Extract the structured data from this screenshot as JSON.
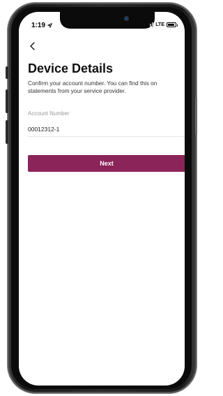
{
  "status_bar": {
    "time": "1:19",
    "network": "LTE"
  },
  "header": {
    "back_icon": "chevron-left-icon",
    "title": "Device Details",
    "subtitle": "Confirm your account number. You can find this on statements from your service provider."
  },
  "form": {
    "account_label": "Account Number",
    "account_value": "00012312-1"
  },
  "actions": {
    "next_label": "Next"
  },
  "colors": {
    "accent": "#8b2459",
    "label_gray": "#9a9a9a"
  }
}
